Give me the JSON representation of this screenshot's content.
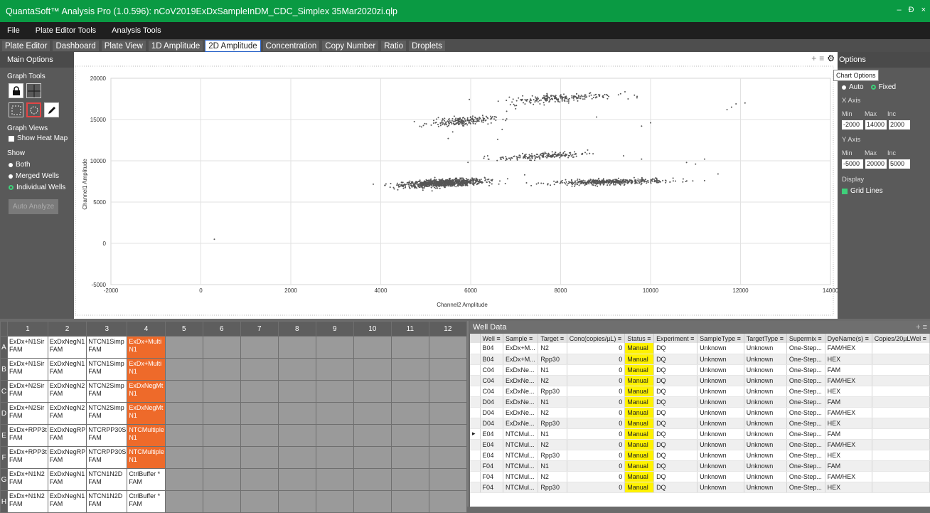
{
  "app": {
    "title": "QuantaSoft™ Analysis Pro (1.0.596): nCoV2019ExDxSampleInDM_CDC_Simplex 35Mar2020zi.qlp",
    "min_label": "–",
    "max_label": "Ɖ",
    "close_label": "×"
  },
  "menu": [
    "File",
    "Plate Editor Tools",
    "Analysis Tools"
  ],
  "tabs": [
    "Plate Editor",
    "Dashboard",
    "Plate View",
    "1D Amplitude",
    "2D Amplitude",
    "Concentration",
    "Copy Number",
    "Ratio",
    "Droplets"
  ],
  "active_tab": "2D Amplitude",
  "left": {
    "header": "Main Options",
    "graph_tools": "Graph Tools",
    "graph_views": "Graph Views",
    "heat_map": "Show Heat Map",
    "show": "Show",
    "show_options": [
      "Both",
      "Merged Wells",
      "Individual Wells"
    ],
    "auto_analyze": "Auto Analyze"
  },
  "right": {
    "header": "Options",
    "tooltip": "Chart Options",
    "auto": "Auto",
    "fixed": "Fixed",
    "x_axis": "X Axis",
    "y_axis": "Y Axis",
    "min": "Min",
    "max": "Max",
    "inc": "Inc",
    "x_min": "-2000",
    "x_max": "14000",
    "x_inc": "2000",
    "y_min": "-5000",
    "y_max": "20000",
    "y_inc": "5000",
    "display": "Display",
    "grid_lines": "Grid Lines"
  },
  "chart_data": {
    "type": "scatter",
    "xlabel": "Channel2 Amplitude",
    "ylabel": "Channel1 Amplitude",
    "xlim": [
      -2000,
      14000
    ],
    "ylim": [
      -5000,
      20000
    ],
    "xticks": [
      -2000,
      0,
      2000,
      4000,
      6000,
      8000,
      10000,
      12000,
      14000
    ],
    "yticks": [
      -5000,
      0,
      5000,
      10000,
      15000,
      20000
    ],
    "grid": true,
    "clusters": [
      {
        "x": 5400,
        "y": 7300,
        "sx": 450,
        "sy": 220,
        "n": 900,
        "tilt": 0.25
      },
      {
        "x": 9100,
        "y": 7450,
        "sx": 620,
        "sy": 160,
        "n": 450,
        "tilt": 0.1
      },
      {
        "x": 5800,
        "y": 14800,
        "sx": 350,
        "sy": 250,
        "n": 200,
        "tilt": 0.35
      },
      {
        "x": 7600,
        "y": 10600,
        "sx": 500,
        "sy": 200,
        "n": 180,
        "tilt": 0.3
      },
      {
        "x": 8000,
        "y": 17600,
        "sx": 600,
        "sy": 260,
        "n": 210,
        "tilt": 0.35
      }
    ],
    "scatter_points": [
      [
        300,
        500
      ],
      [
        11900,
        16900
      ],
      [
        11800,
        16500
      ],
      [
        12100,
        17000
      ],
      [
        11700,
        16200
      ],
      [
        10800,
        9800
      ],
      [
        11200,
        10200
      ],
      [
        9800,
        10200
      ],
      [
        4300,
        6600
      ],
      [
        4500,
        6900
      ],
      [
        6700,
        13800
      ],
      [
        10000,
        14600
      ],
      [
        9800,
        14200
      ],
      [
        11000,
        9600
      ],
      [
        7200,
        8300
      ],
      [
        5600,
        13500
      ],
      [
        5500,
        12700
      ],
      [
        10500,
        7900
      ],
      [
        11200,
        7600
      ],
      [
        11500,
        8400
      ],
      [
        7000,
        16300
      ],
      [
        6800,
        16000
      ],
      [
        9500,
        17500
      ],
      [
        9700,
        17800
      ],
      [
        8800,
        15300
      ],
      [
        6600,
        12600
      ],
      [
        9400,
        10600
      ]
    ]
  },
  "chart_ctl": {
    "plus": "+",
    "menu": "≡",
    "gear": "⚙"
  },
  "plate": {
    "columns": [
      "1",
      "2",
      "3",
      "4",
      "5",
      "6",
      "7",
      "8",
      "9",
      "10",
      "11",
      "12"
    ],
    "rows": [
      {
        "label": "A",
        "cells": [
          "ExDx+N1Sir\nFAM",
          "ExDxNegN1\nFAM",
          "NTCN1Simp\nFAM",
          "ExDx+Multi\nN1"
        ]
      },
      {
        "label": "B",
        "cells": [
          "ExDx+N1Sir\nFAM",
          "ExDxNegN1\nFAM",
          "NTCN1Simp\nFAM",
          "ExDx+Multi\nN1"
        ]
      },
      {
        "label": "C",
        "cells": [
          "ExDx+N2Sir\nFAM",
          "ExDxNegN2\nFAM",
          "NTCN2Simp\nFAM",
          "ExDxNegMt\nN1"
        ]
      },
      {
        "label": "D",
        "cells": [
          "ExDx+N2Sir\nFAM",
          "ExDxNegN2\nFAM",
          "NTCN2Simp\nFAM",
          "ExDxNegMt\nN1"
        ]
      },
      {
        "label": "E",
        "cells": [
          "ExDx+RPP3t\nFAM",
          "ExDxNegRP\nFAM",
          "NTCRPP30S\nFAM",
          "NTCMultiple\nN1"
        ]
      },
      {
        "label": "F",
        "cells": [
          "ExDx+RPP3t\nFAM",
          "ExDxNegRP\nFAM",
          "NTCRPP30S\nFAM",
          "NTCMultiple\nN1"
        ]
      },
      {
        "label": "G",
        "cells": [
          "ExDx+N1N2\nFAM",
          "ExDxNegN1\nFAM",
          "NTCN1N2D\nFAM",
          "CtrlBuffer *\nFAM"
        ]
      },
      {
        "label": "H",
        "cells": [
          "ExDx+N1N2\nFAM",
          "ExDxNegN1\nFAM",
          "NTCN1N2D\nFAM",
          "CtrlBuffer *\nFAM"
        ]
      }
    ]
  },
  "well_data": {
    "title": "Well Data",
    "ctl": "+ ≡",
    "headers": [
      "",
      "Well",
      "Sample",
      "Target",
      "Conc(copies/µL)",
      "Status",
      "Experiment",
      "SampleType",
      "TargetType",
      "Supermix",
      "DyeName(s)",
      "Copies/20µLWel"
    ],
    "rows": [
      [
        "",
        "B04",
        "ExDx+M...",
        "N2",
        "0",
        "Manual",
        "DQ",
        "Unknown",
        "Unknown",
        "One-Step...",
        "FAM/HEX",
        ""
      ],
      [
        "",
        "B04",
        "ExDx+M...",
        "Rpp30",
        "0",
        "Manual",
        "DQ",
        "Unknown",
        "Unknown",
        "One-Step...",
        "HEX",
        ""
      ],
      [
        "",
        "C04",
        "ExDxNe...",
        "N1",
        "0",
        "Manual",
        "DQ",
        "Unknown",
        "Unknown",
        "One-Step...",
        "FAM",
        ""
      ],
      [
        "",
        "C04",
        "ExDxNe...",
        "N2",
        "0",
        "Manual",
        "DQ",
        "Unknown",
        "Unknown",
        "One-Step...",
        "FAM/HEX",
        ""
      ],
      [
        "",
        "C04",
        "ExDxNe...",
        "Rpp30",
        "0",
        "Manual",
        "DQ",
        "Unknown",
        "Unknown",
        "One-Step...",
        "HEX",
        ""
      ],
      [
        "",
        "D04",
        "ExDxNe...",
        "N1",
        "0",
        "Manual",
        "DQ",
        "Unknown",
        "Unknown",
        "One-Step...",
        "FAM",
        ""
      ],
      [
        "",
        "D04",
        "ExDxNe...",
        "N2",
        "0",
        "Manual",
        "DQ",
        "Unknown",
        "Unknown",
        "One-Step...",
        "FAM/HEX",
        ""
      ],
      [
        "",
        "D04",
        "ExDxNe...",
        "Rpp30",
        "0",
        "Manual",
        "DQ",
        "Unknown",
        "Unknown",
        "One-Step...",
        "HEX",
        ""
      ],
      [
        "▸",
        "E04",
        "NTCMul...",
        "N1",
        "0",
        "Manual",
        "DQ",
        "Unknown",
        "Unknown",
        "One-Step...",
        "FAM",
        ""
      ],
      [
        "",
        "E04",
        "NTCMul...",
        "N2",
        "0",
        "Manual",
        "DQ",
        "Unknown",
        "Unknown",
        "One-Step...",
        "FAM/HEX",
        ""
      ],
      [
        "",
        "E04",
        "NTCMul...",
        "Rpp30",
        "0",
        "Manual",
        "DQ",
        "Unknown",
        "Unknown",
        "One-Step...",
        "HEX",
        ""
      ],
      [
        "",
        "F04",
        "NTCMul...",
        "N1",
        "0",
        "Manual",
        "DQ",
        "Unknown",
        "Unknown",
        "One-Step...",
        "FAM",
        ""
      ],
      [
        "",
        "F04",
        "NTCMul...",
        "N2",
        "0",
        "Manual",
        "DQ",
        "Unknown",
        "Unknown",
        "One-Step...",
        "FAM/HEX",
        ""
      ],
      [
        "",
        "F04",
        "NTCMul...",
        "Rpp30",
        "0",
        "Manual",
        "DQ",
        "Unknown",
        "Unknown",
        "One-Step...",
        "HEX",
        ""
      ]
    ]
  },
  "colors": {
    "titlebar": "#0a9a43",
    "status_manual": "#fff200",
    "plate_highlight": "#ee6a2a",
    "active_tab_border": "#2a64c8"
  }
}
